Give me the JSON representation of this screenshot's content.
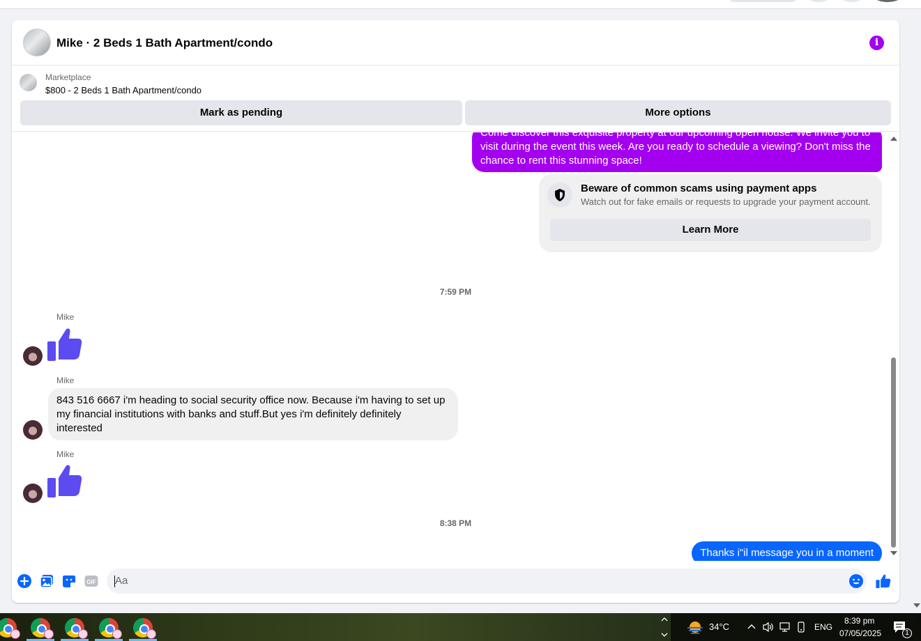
{
  "header": {
    "title": "Mike · 2 Beds 1 Bath Apartment/condo",
    "info_icon": "info-icon"
  },
  "listing": {
    "source": "Marketplace",
    "price_title": "$800 - 2 Beds 1 Bath Apartment/condo",
    "mark_pending_label": "Mark as pending",
    "more_options_label": "More options"
  },
  "messages": {
    "outgoing_promo": "Come discover this exquisite property at our upcoming open house. We invite you to visit during the event this week. Are you ready to schedule a viewing? Don't miss the chance to rent this stunning space!",
    "scam_title": "Beware of common scams using payment apps",
    "scam_subtitle": "Watch out for fake emails or requests to upgrade your payment account.",
    "learn_more_label": "Learn More",
    "time_1": "7:59 PM",
    "sender_1": "Mike",
    "sender_2": "Mike",
    "incoming_text": "843 516 6667  i'm heading to social security office now. Because i'm having to set up my financial institutions with banks and stuff.But yes i'm definitely definitely interested",
    "sender_3": "Mike",
    "time_2": "8:38 PM",
    "outgoing_reply": "Thanks i\"il message you in a moment"
  },
  "composer": {
    "placeholder": "Aa"
  },
  "taskbar": {
    "temperature": "34°C",
    "language": "ENG",
    "time": "8:39 pm",
    "date": "07/05/2025",
    "notification_count": "1"
  },
  "colors": {
    "accent_purple": "#a400f0",
    "messenger_blue": "#0866ff",
    "like_indigo": "#5b4bf0"
  }
}
